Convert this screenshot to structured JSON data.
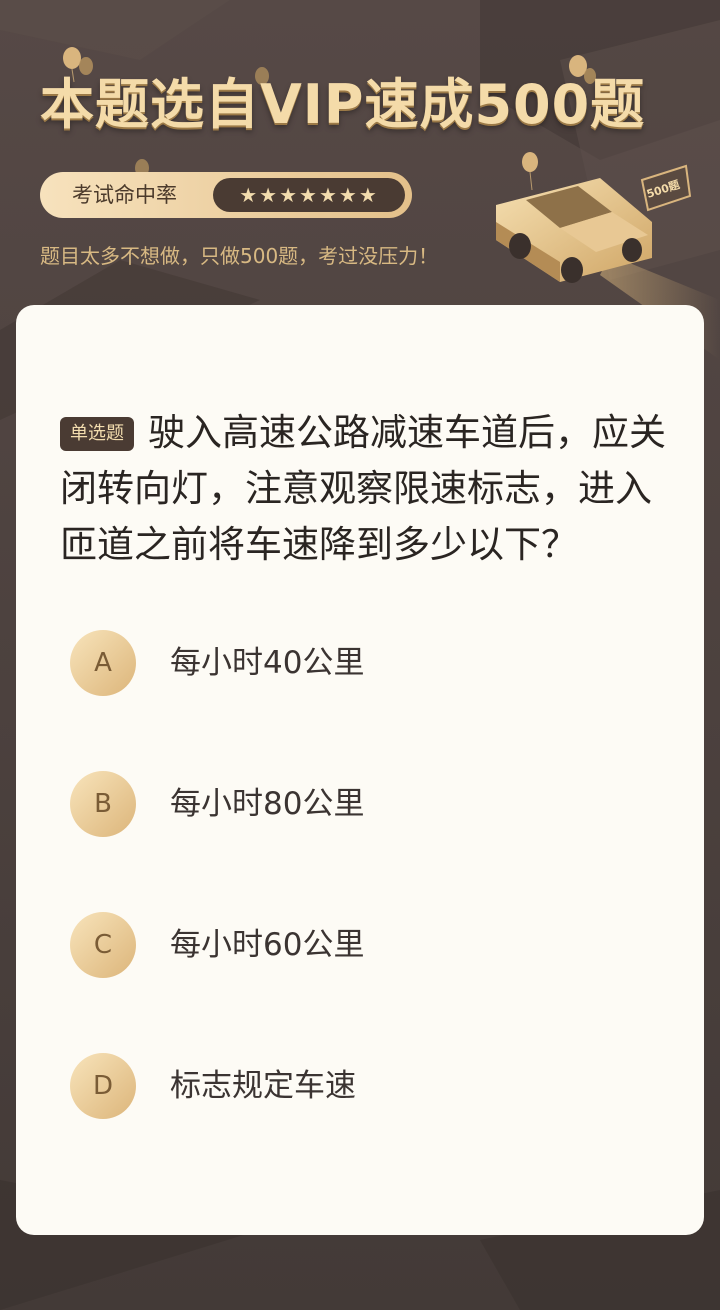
{
  "header": {
    "title": "本题选自VIP速成500题",
    "rate_label": "考试命中率",
    "rate_stars": "★★★★★★★",
    "subtitle": "题目太多不想做，只做500题，考过没压力！",
    "car_badge": "500题"
  },
  "question": {
    "type_badge": "单选题",
    "text": "驶入高速公路减速车道后，应关闭转向灯，注意观察限速标志，进入匝道之前将车速降到多少以下？",
    "options": [
      {
        "letter": "A",
        "text": "每小时40公里"
      },
      {
        "letter": "B",
        "text": "每小时80公里"
      },
      {
        "letter": "C",
        "text": "每小时60公里"
      },
      {
        "letter": "D",
        "text": "标志规定车速"
      }
    ]
  },
  "colors": {
    "background": "#4a403d",
    "gold": "#f4dba9",
    "card": "#fdfbf5",
    "badge_dark": "#4a3b33"
  }
}
